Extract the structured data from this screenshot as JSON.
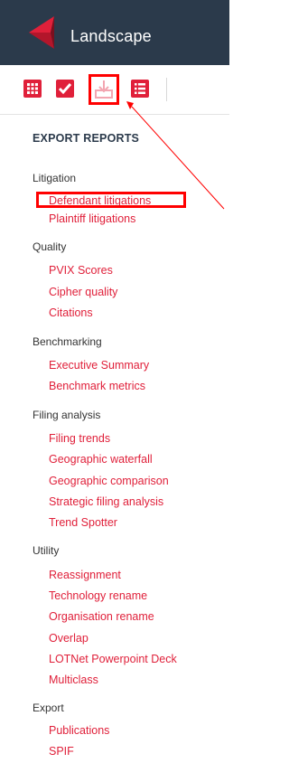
{
  "app": {
    "title": "Landscape"
  },
  "toolbar": {
    "icons": [
      "grid-icon",
      "check-icon",
      "export-icon",
      "list-icon"
    ],
    "accent": "#e0203a"
  },
  "panel": {
    "title": "EXPORT REPORTS",
    "groups": [
      {
        "label": "Litigation",
        "items": [
          "Defendant litigations",
          "Plaintiff litigations"
        ]
      },
      {
        "label": "Quality",
        "items": [
          "PVIX Scores",
          "Cipher quality",
          "Citations"
        ]
      },
      {
        "label": "Benchmarking",
        "items": [
          "Executive Summary",
          "Benchmark metrics"
        ]
      },
      {
        "label": "Filing analysis",
        "items": [
          "Filing trends",
          "Geographic waterfall",
          "Geographic comparison",
          "Strategic filing analysis",
          "Trend Spotter"
        ]
      },
      {
        "label": "Utility",
        "items": [
          "Reassignment",
          "Technology rename",
          "Organisation rename",
          "Overlap",
          "LOTNet Powerpoint Deck",
          "Multiclass"
        ]
      },
      {
        "label": "Export",
        "items": [
          "Publications",
          "SPIF"
        ]
      }
    ]
  }
}
